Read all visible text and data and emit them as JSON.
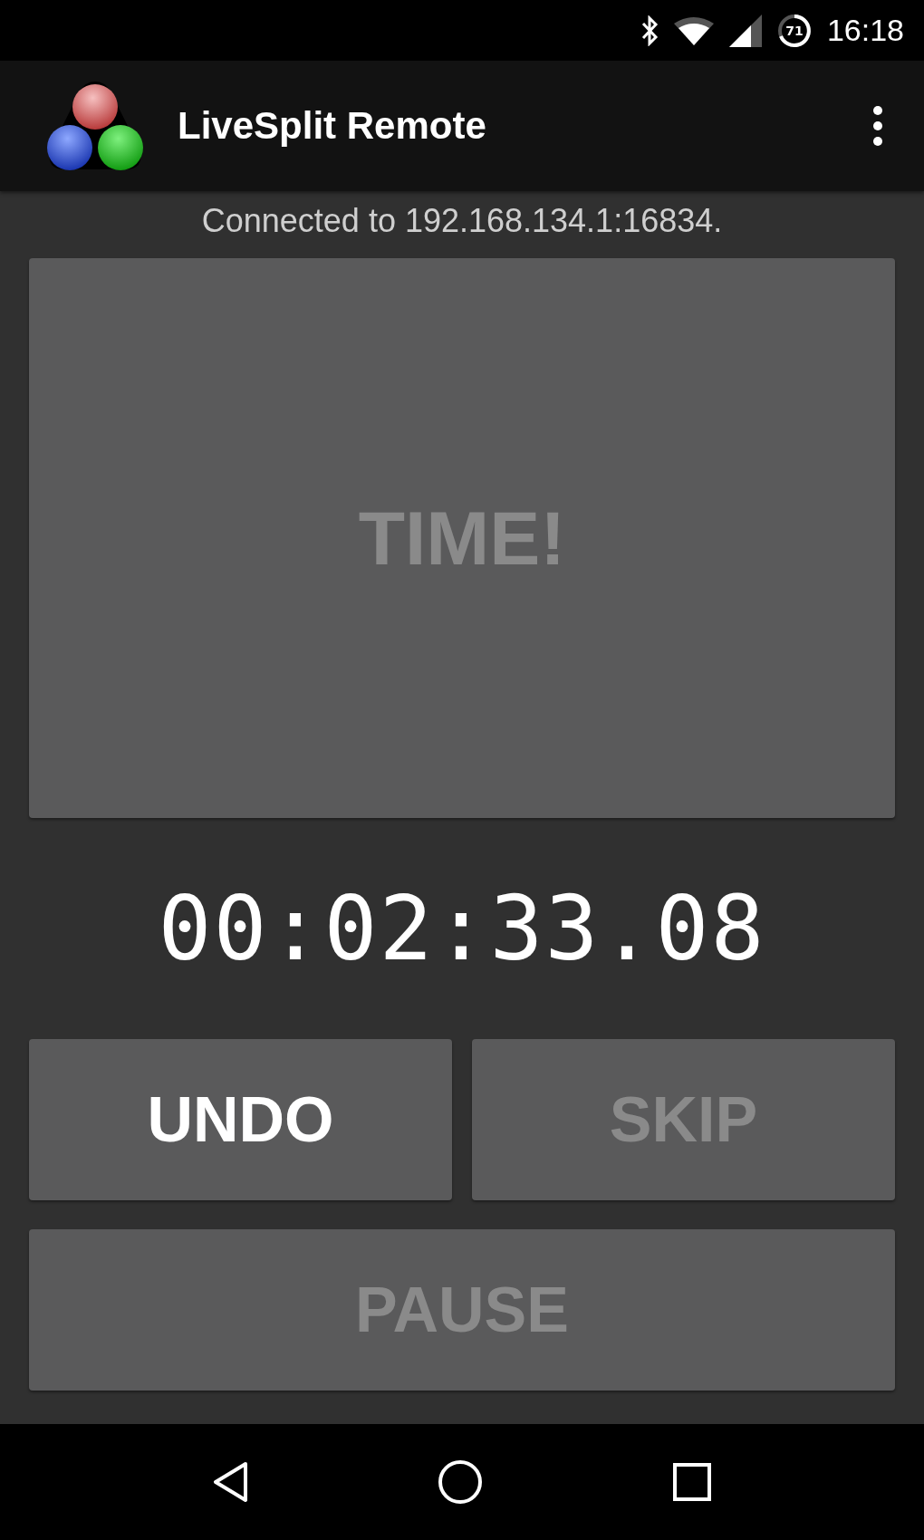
{
  "status_bar": {
    "battery": "71",
    "time": "16:18"
  },
  "app_bar": {
    "title": "LiveSplit Remote"
  },
  "connection": "Connected to 192.168.134.1:16834.",
  "main_button": {
    "label": "TIME!",
    "disabled": true
  },
  "timer": "00:02:33.08",
  "buttons": [
    {
      "label": "UNDO",
      "disabled": false
    },
    {
      "label": "SKIP",
      "disabled": true
    },
    {
      "label": "PAUSE",
      "disabled": true
    }
  ]
}
